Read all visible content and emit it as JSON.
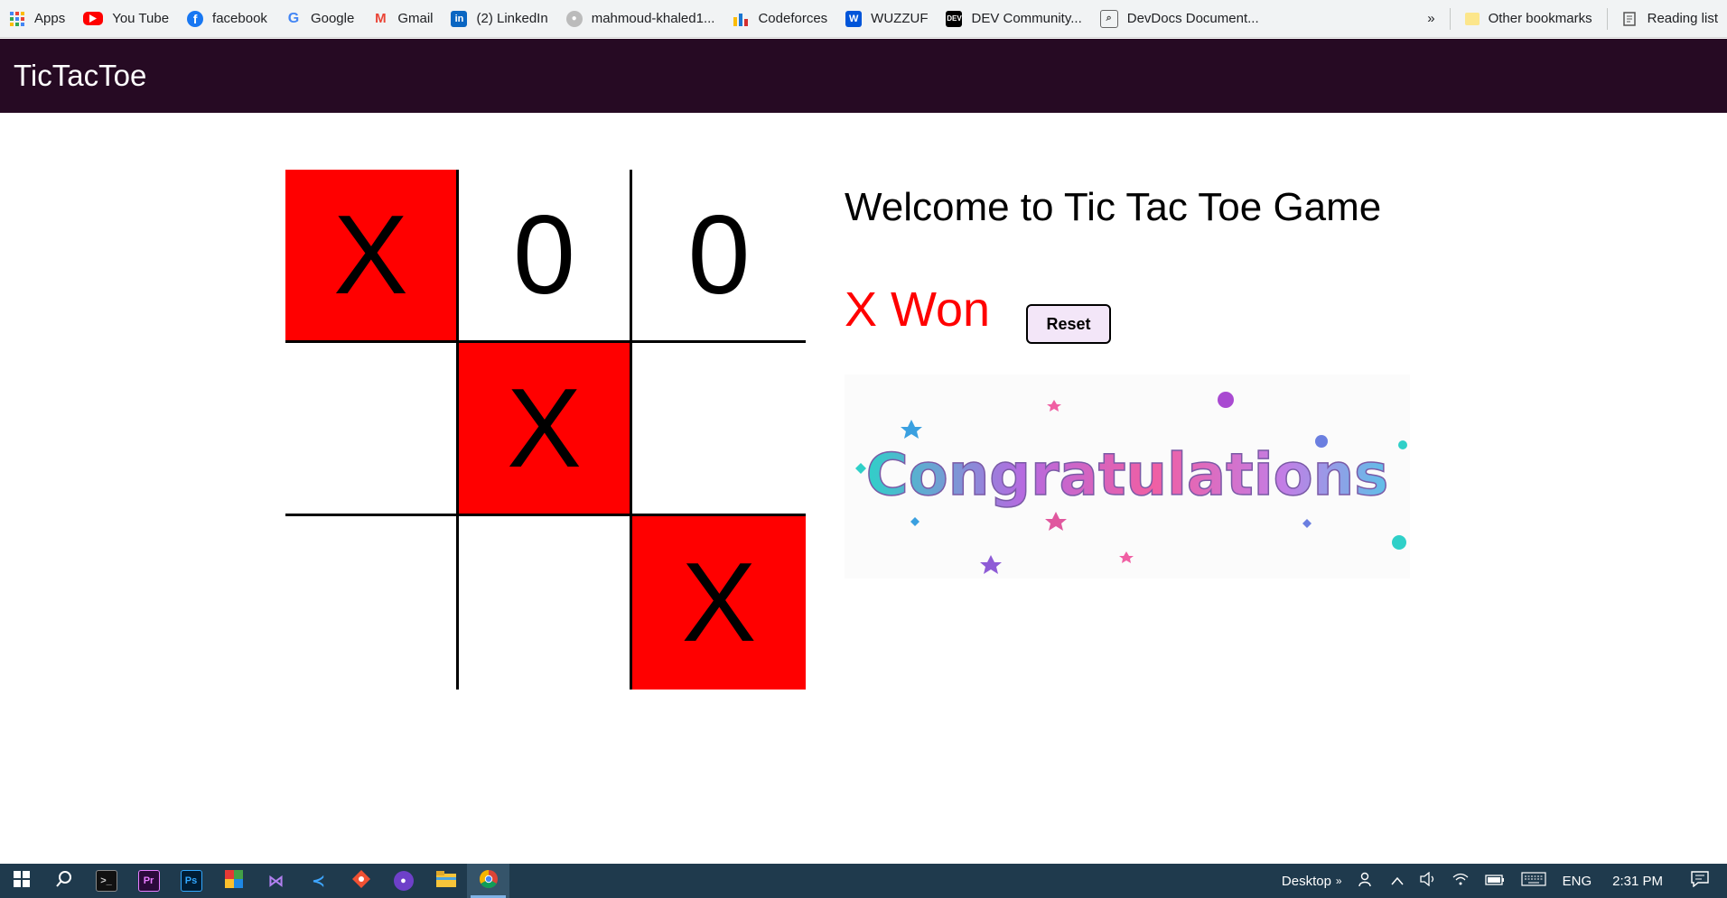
{
  "bookmarks": [
    {
      "label": "Apps",
      "icon": "apps-grid-icon"
    },
    {
      "label": "You Tube",
      "icon": "youtube-icon"
    },
    {
      "label": "facebook",
      "icon": "facebook-icon"
    },
    {
      "label": "Google",
      "icon": "google-icon"
    },
    {
      "label": "Gmail",
      "icon": "gmail-icon"
    },
    {
      "label": "(2) LinkedIn",
      "icon": "linkedin-icon"
    },
    {
      "label": "mahmoud-khaled1...",
      "icon": "github-icon"
    },
    {
      "label": "Codeforces",
      "icon": "codeforces-icon"
    },
    {
      "label": "WUZZUF",
      "icon": "wuzzuf-icon"
    },
    {
      "label": "DEV Community...",
      "icon": "dev-icon"
    },
    {
      "label": "DevDocs Document...",
      "icon": "devdocs-icon"
    }
  ],
  "bookmarks_overflow": "»",
  "other_bookmarks": "Other bookmarks",
  "reading_list": "Reading list",
  "app": {
    "title": "TicTacToe",
    "welcome": "Welcome to Tic Tac Toe Game",
    "status": "X Won",
    "reset_label": "Reset",
    "congrats_text": "Congratulations",
    "board": [
      [
        "X",
        "0",
        "0"
      ],
      [
        "",
        "X",
        ""
      ],
      [
        "",
        "",
        "X"
      ]
    ],
    "winning_cells": [
      [
        0,
        0
      ],
      [
        1,
        1
      ],
      [
        2,
        2
      ]
    ],
    "win_color": "#ff0000",
    "header_color": "#260a23"
  },
  "taskbar": {
    "apps": [
      "windows-start-icon",
      "search-icon",
      "terminal-icon",
      "premiere-icon",
      "photoshop-icon",
      "winrar-icon",
      "visual-studio-icon",
      "vscode-icon",
      "git-icon",
      "github-desktop-icon",
      "file-explorer-icon",
      "chrome-icon"
    ],
    "desktop_label": "Desktop",
    "desktop_chevron": "»",
    "language": "ENG",
    "time": "2:31 PM"
  }
}
